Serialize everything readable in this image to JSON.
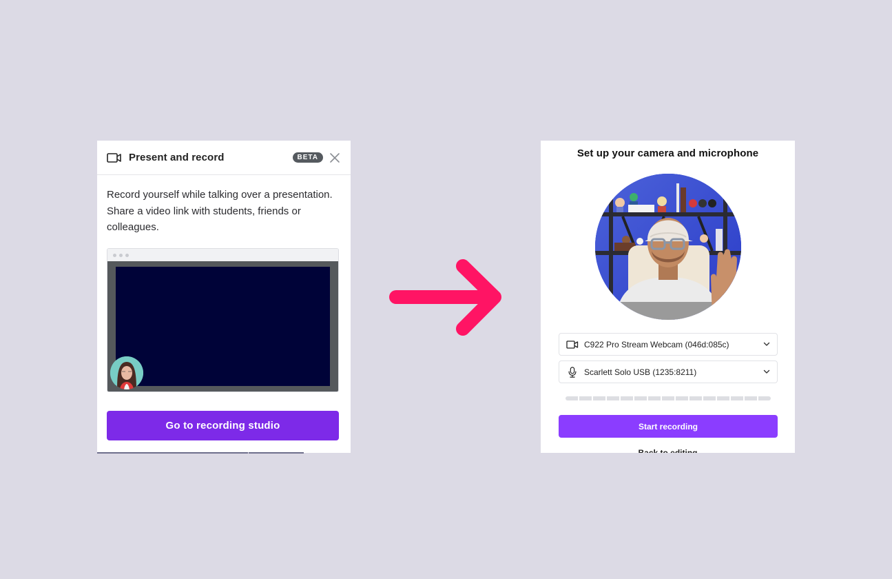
{
  "left_panel": {
    "title": "Present and record",
    "badge": "BETA",
    "description": "Record yourself while talking over a presentation. Share a video link with students, friends or colleagues.",
    "preview": {
      "slide_color": "#000338",
      "frame_color": "#55595c"
    },
    "cta_label": "Go to recording studio",
    "cta_color": "#7d2ae8",
    "icons": {
      "header": "video-camera-icon",
      "close": "close-icon"
    }
  },
  "arrow": {
    "icon": "arrow-right-icon",
    "color": "#ff1464"
  },
  "right_panel": {
    "title": "Set up your camera and microphone",
    "camera_select": {
      "icon": "video-camera-icon",
      "value": "C922 Pro Stream Webcam (046d:085c)"
    },
    "mic_select": {
      "icon": "microphone-icon",
      "value": "Scarlett Solo USB (1235:8211)"
    },
    "audio_level": {
      "segments": 15,
      "active": 0
    },
    "start_label": "Start recording",
    "start_color": "#8b3dff",
    "back_label": "Back to editing"
  }
}
